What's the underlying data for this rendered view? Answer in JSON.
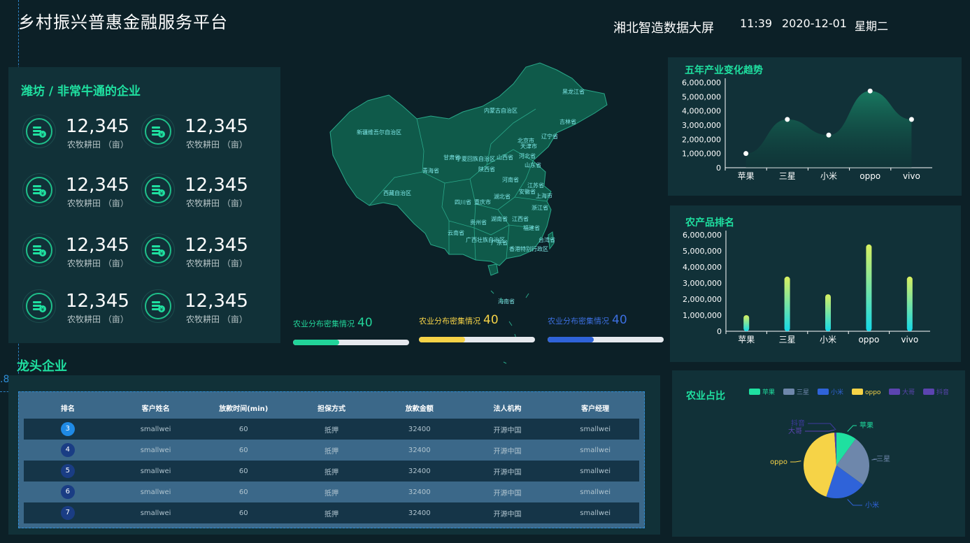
{
  "header": {
    "title": "乡村振兴普惠金融服务平台",
    "brand": "湘北智造数据大屏",
    "time": "11:39",
    "date": "2020-12-01",
    "weekday": "星期二",
    "guide_value": ".8"
  },
  "stats": {
    "title": "潍坊 / 非常牛通的企业",
    "items": [
      {
        "value": "12,345",
        "label": "农牧耕田 （亩）"
      },
      {
        "value": "12,345",
        "label": "农牧耕田 （亩）"
      },
      {
        "value": "12,345",
        "label": "农牧耕田 （亩）"
      },
      {
        "value": "12,345",
        "label": "农牧耕田 （亩）"
      },
      {
        "value": "12,345",
        "label": "农牧耕田 （亩）"
      },
      {
        "value": "12,345",
        "label": "农牧耕田 （亩）"
      },
      {
        "value": "12,345",
        "label": "农牧耕田 （亩）"
      },
      {
        "value": "12,345",
        "label": "农牧耕田 （亩）"
      }
    ]
  },
  "map": {
    "provinces": [
      "新疆维吾尔自治区",
      "内蒙古自治区",
      "黑龙江省",
      "吉林省",
      "辽宁省",
      "北京市",
      "天津市",
      "河北省",
      "山西省",
      "山东省",
      "甘肃省",
      "宁夏回族自治区",
      "陕西省",
      "青海省",
      "河南省",
      "江苏省",
      "安徽省",
      "上海市",
      "西藏自治区",
      "四川省",
      "重庆市",
      "湖北省",
      "浙江省",
      "湖南省",
      "江西省",
      "贵州省",
      "福建省",
      "云南省",
      "广西壮族自治区",
      "广东省",
      "台湾省",
      "香港特别行政区",
      "海南省"
    ]
  },
  "progress": [
    {
      "label": "农业分布密集情况",
      "value": "40",
      "fraction": 0.4,
      "color": "#22d399",
      "label_color": "#22d399"
    },
    {
      "label": "农业分布密集情况",
      "value": "40",
      "fraction": 0.4,
      "color": "#f6d347",
      "label_color": "#f6d347"
    },
    {
      "label": "农业分布密集情况",
      "value": "40",
      "fraction": 0.4,
      "color": "#2f63d9",
      "label_color": "#3c6fe0"
    }
  ],
  "leaders": {
    "title": "龙头企业",
    "columns": [
      "排名",
      "客户姓名",
      "放款时间(min)",
      "担保方式",
      "放款金额",
      "法人机构",
      "客户经理"
    ],
    "rows": [
      {
        "rank": "3",
        "name": "smallwei",
        "time": "60",
        "guarantee": "抵押",
        "amount": "32400",
        "org": "开源中国",
        "manager": "smallwei"
      },
      {
        "rank": "4",
        "name": "smallwei",
        "time": "60",
        "guarantee": "抵押",
        "amount": "32400",
        "org": "开源中国",
        "manager": "smallwei"
      },
      {
        "rank": "5",
        "name": "smallwei",
        "time": "60",
        "guarantee": "抵押",
        "amount": "32400",
        "org": "开源中国",
        "manager": "smallwei"
      },
      {
        "rank": "6",
        "name": "smallwei",
        "time": "60",
        "guarantee": "抵押",
        "amount": "32400",
        "org": "开源中国",
        "manager": "smallwei"
      },
      {
        "rank": "7",
        "name": "smallwei",
        "time": "60",
        "guarantee": "抵押",
        "amount": "32400",
        "org": "开源中国",
        "manager": "smallwei"
      }
    ]
  },
  "chart_data": [
    {
      "type": "area",
      "title": "五年产业变化趋势",
      "categories": [
        "苹果",
        "三星",
        "小米",
        "oppo",
        "vivo"
      ],
      "values": [
        1000000,
        3400000,
        2300000,
        5400000,
        3400000
      ],
      "ylim": [
        0,
        6000000
      ],
      "yticks": [
        "0",
        "1,000,000",
        "2,000,000",
        "3,000,000",
        "4,000,000",
        "5,000,000",
        "6,000,000"
      ],
      "color": "#1fbf8a"
    },
    {
      "type": "bar",
      "title": "农产品排名",
      "categories": [
        "苹果",
        "三星",
        "小米",
        "oppo",
        "vivo"
      ],
      "values": [
        1000000,
        3400000,
        2300000,
        5400000,
        3400000
      ],
      "ylim": [
        0,
        6000000
      ],
      "yticks": [
        "0",
        "1,000,000",
        "2,000,000",
        "3,000,000",
        "4,000,000",
        "5,000,000",
        "6,000,000"
      ]
    },
    {
      "type": "pie",
      "title": "农业占比",
      "legend": [
        {
          "name": "苹果",
          "color": "#1fe0a0"
        },
        {
          "name": "三星",
          "color": "#6e87ab"
        },
        {
          "name": "小米",
          "color": "#2f63d9"
        },
        {
          "name": "oppo",
          "color": "#f6d347"
        },
        {
          "name": "大哥",
          "color": "#5b44b0"
        },
        {
          "name": "抖音",
          "color": "#5b44b0"
        }
      ],
      "slices": [
        {
          "name": "苹果",
          "value": 10,
          "color": "#1fe0a0"
        },
        {
          "name": "三星",
          "value": 25,
          "color": "#6e87ab"
        },
        {
          "name": "小米",
          "value": 20,
          "color": "#2f63d9"
        },
        {
          "name": "oppo",
          "value": 44,
          "color": "#f6d347"
        },
        {
          "name": "大哥",
          "value": 0.5,
          "color": "#5b44b0"
        },
        {
          "name": "抖音",
          "value": 0.5,
          "color": "#3f3aa0"
        }
      ],
      "outside_labels": [
        "抖音",
        "大哥",
        "苹果",
        "三星",
        "小米",
        "oppo"
      ]
    }
  ]
}
